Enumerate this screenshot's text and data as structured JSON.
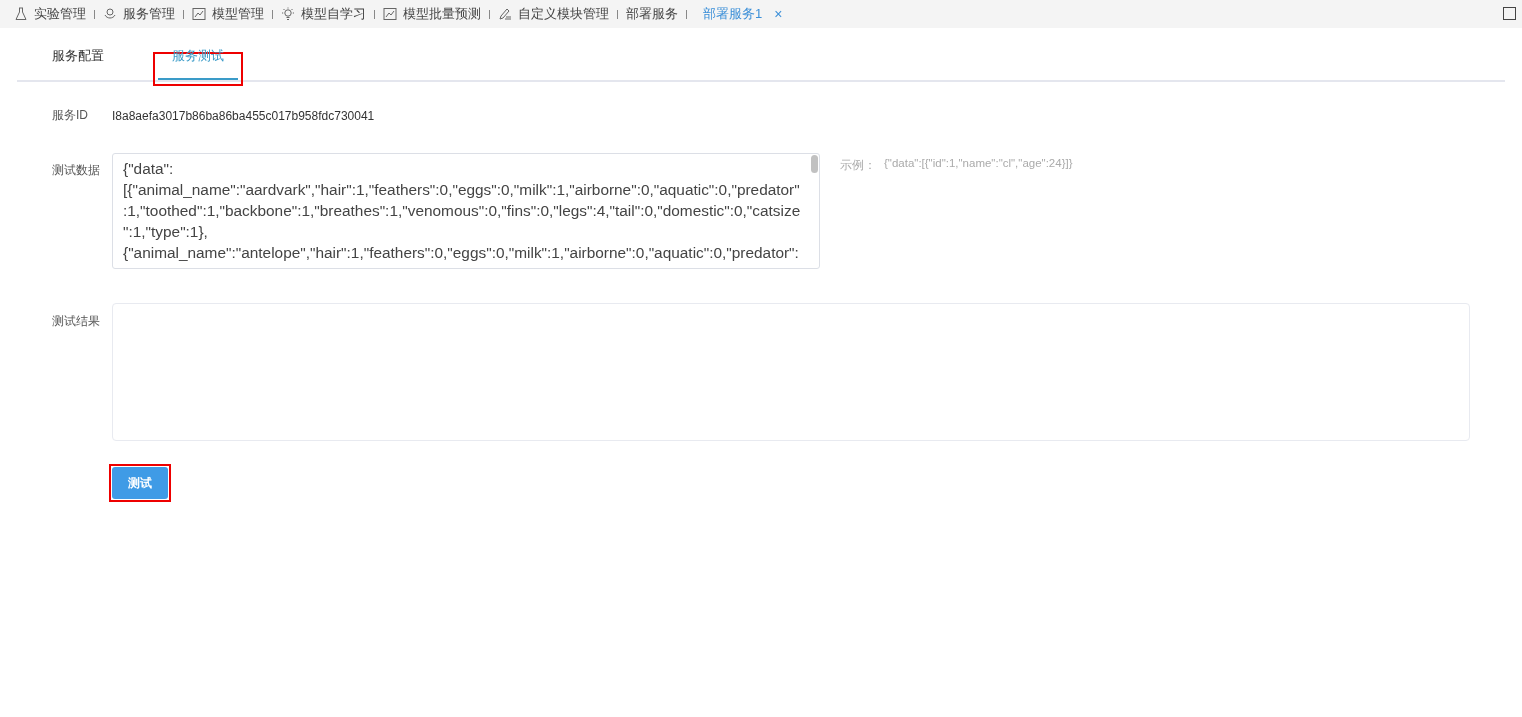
{
  "nav_tabs": [
    {
      "label": "实验管理",
      "selected": false
    },
    {
      "label": "服务管理",
      "selected": false
    },
    {
      "label": "模型管理",
      "selected": false
    },
    {
      "label": "模型自学习",
      "selected": false
    },
    {
      "label": "模型批量预测",
      "selected": false
    },
    {
      "label": "自定义模块管理",
      "selected": false
    },
    {
      "label": "部署服务",
      "selected": false
    },
    {
      "label": "部署服务1",
      "selected": true,
      "close": "×"
    }
  ],
  "sub_tabs": [
    {
      "label": "服务配置",
      "selected": false,
      "highlighted": false
    },
    {
      "label": "服务测试",
      "selected": true,
      "highlighted": true
    }
  ],
  "service_id": {
    "label": "服务ID",
    "value": "I8a8aefa3017b86ba86ba455c017b958fdc730041"
  },
  "test_data": {
    "label": "测试数据",
    "lines": [
      "{\"data\":",
      "[{\"animal_name\":\"aardvark\",\"hair\":1,\"feathers\":0,\"eggs\":0,\"milk\":1,\"airborne\":0,\"aquatic\":0,\"predator\"",
      ":1,\"toothed\":1,\"backbone\":1,\"breathes\":1,\"venomous\":0,\"fins\":0,\"legs\":4,\"tail\":0,\"domestic\":0,\"catsize",
      "\":1,\"type\":1},",
      "{\"animal_name\":\"antelope\",\"hair\":1,\"feathers\":0,\"eggs\":0,\"milk\":1,\"airborne\":0,\"aquatic\":0,\"predator\":"
    ],
    "example_label": "示例：",
    "example": "{\"data\":[{\"id\":1,\"name\":\"cl\",\"age\":24}]}"
  },
  "test_result": {
    "label": "测试结果"
  },
  "test_button": {
    "label": "测试",
    "highlighted": true
  }
}
